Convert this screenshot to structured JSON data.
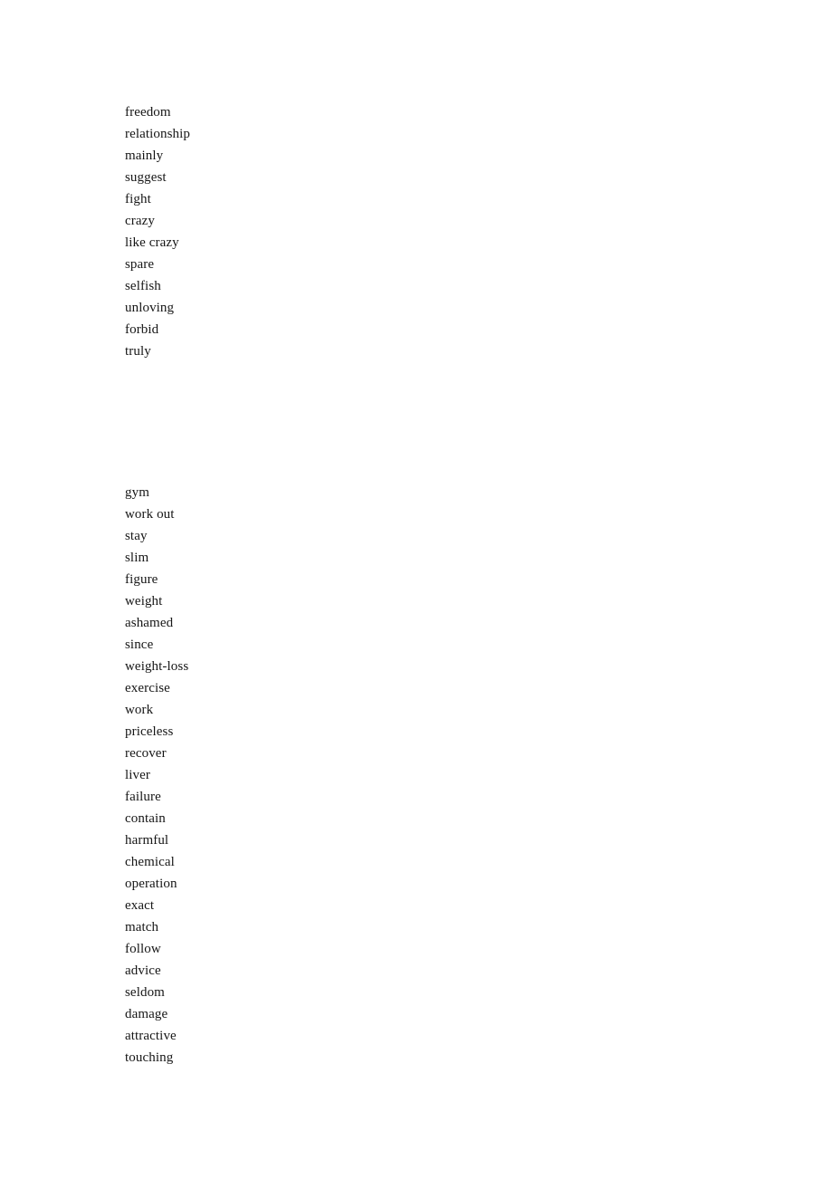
{
  "document": {
    "type": "word-list",
    "page_background": "#ffffff",
    "text_color": "#161616",
    "blocks": [
      {
        "id": "block-1",
        "name": "vocabulary-list-one",
        "words": [
          "freedom",
          "relationship",
          "mainly",
          "suggest",
          "fight",
          "crazy",
          "like crazy",
          "spare",
          "selfish",
          "unloving",
          "forbid",
          "truly"
        ]
      },
      {
        "id": "block-2",
        "name": "vocabulary-list-two",
        "words": [
          "gym",
          "work out",
          "stay",
          "slim",
          "figure",
          "weight",
          "ashamed",
          "since",
          "weight-loss",
          "exercise",
          "work",
          "priceless",
          "recover",
          "liver",
          "failure",
          "contain",
          "harmful",
          "chemical",
          "operation",
          "exact",
          "match",
          "follow",
          "advice",
          "seldom",
          "damage",
          "attractive",
          "touching"
        ]
      }
    ]
  }
}
